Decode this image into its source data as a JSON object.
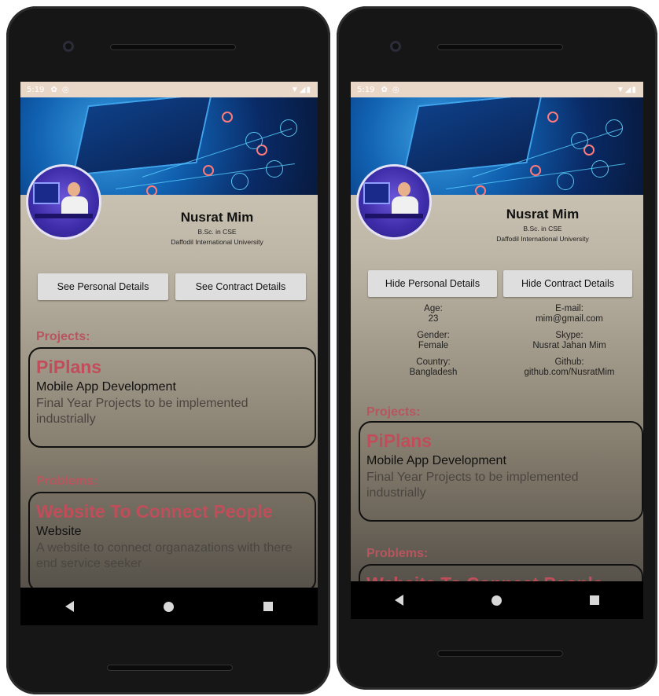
{
  "status_bar": {
    "time": "5:19",
    "right_icons": "▼◢▮"
  },
  "profile": {
    "name": "Nusrat Mim",
    "degree": "B.Sc. in CSE",
    "university": "Daffodil International University"
  },
  "left_phone": {
    "buttons": {
      "personal": "See Personal Details",
      "contract": "See Contract Details"
    },
    "projects_label": "Projects:",
    "project": {
      "title": "PiPlans",
      "category": "Mobile App Development",
      "description": "Final Year Projects to be implemented industrially"
    },
    "problems_label": "Problems:",
    "problem": {
      "title": "Website To Connect People",
      "category": "Website",
      "description": "A website to connect organazations with there end service seeker"
    }
  },
  "right_phone": {
    "buttons": {
      "personal": "Hide Personal Details",
      "contract": "Hide Contract Details"
    },
    "details_left": [
      {
        "label": "Age:",
        "value": "23"
      },
      {
        "label": "Gender:",
        "value": "Female"
      },
      {
        "label": "Country:",
        "value": "Bangladesh"
      }
    ],
    "details_right": [
      {
        "label": "E-mail:",
        "value": "mim@gmail.com"
      },
      {
        "label": "Skype:",
        "value": "Nusrat Jahan Mim"
      },
      {
        "label": "Github:",
        "value": "github.com/NusratMim"
      }
    ],
    "projects_label": "Projects:",
    "project": {
      "title": "PiPlans",
      "category": "Mobile App Development",
      "description": "Final Year Projects to be implemented industrially"
    },
    "problems_label": "Problems:",
    "problem_title": "Website To Connect People"
  },
  "nav_icons": [
    "back-icon",
    "home-icon",
    "recent-apps-icon"
  ]
}
